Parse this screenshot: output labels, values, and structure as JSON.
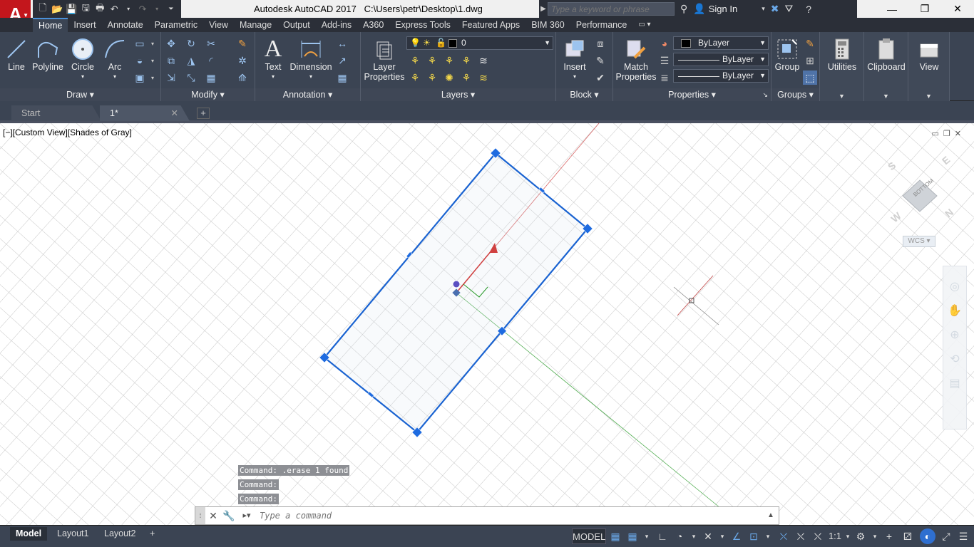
{
  "app": {
    "logo": "A",
    "title": "Autodesk AutoCAD 2017",
    "file_path": "C:\\Users\\petr\\Desktop\\1.dwg"
  },
  "search": {
    "placeholder": "Type a keyword or phrase"
  },
  "account": {
    "signin_label": "Sign In"
  },
  "ribbon_tabs": [
    "Home",
    "Insert",
    "Annotate",
    "Parametric",
    "View",
    "Manage",
    "Output",
    "Add-ins",
    "A360",
    "Express Tools",
    "Featured Apps",
    "BIM 360",
    "Performance"
  ],
  "ribbon": {
    "draw": {
      "title": "Draw",
      "line": "Line",
      "polyline": "Polyline",
      "circle": "Circle",
      "arc": "Arc"
    },
    "modify": {
      "title": "Modify"
    },
    "annotation": {
      "title": "Annotation",
      "text": "Text",
      "dimension": "Dimension"
    },
    "layers": {
      "title": "Layers",
      "layer_properties_1": "Layer",
      "layer_properties_2": "Properties",
      "current_layer": "0"
    },
    "block": {
      "title": "Block",
      "insert": "Insert"
    },
    "properties": {
      "title": "Properties",
      "match_1": "Match",
      "match_2": "Properties",
      "color": "ByLayer",
      "linetype": "ByLayer",
      "lineweight": "ByLayer"
    },
    "groups": {
      "title": "Groups",
      "group": "Group"
    },
    "utilities": {
      "label": "Utilities"
    },
    "clipboard": {
      "label": "Clipboard"
    },
    "view": {
      "label": "View"
    }
  },
  "doc_tabs": [
    "Start",
    "1*"
  ],
  "viewport": {
    "label": "[−][Custom View][Shades of Gray]"
  },
  "viewcube": {
    "face": "BOTTOM",
    "n": "N",
    "s": "S",
    "e": "E",
    "w": "W",
    "wcs": "WCS"
  },
  "command": {
    "history": [
      "Command:  .erase 1 found",
      "Command:",
      "Command:"
    ],
    "placeholder": "Type a command"
  },
  "layouts": [
    "Model",
    "Layout1",
    "Layout2"
  ],
  "status": {
    "model": "MODEL",
    "scale": "1:1"
  },
  "colors": {
    "selection": "#1a63d1",
    "grip": "#1e6be0",
    "ucs_x": "#d04040",
    "ucs_y": "#2a9a2a",
    "ribbon_bg": "#3b4453",
    "brand": "#c3161c"
  }
}
